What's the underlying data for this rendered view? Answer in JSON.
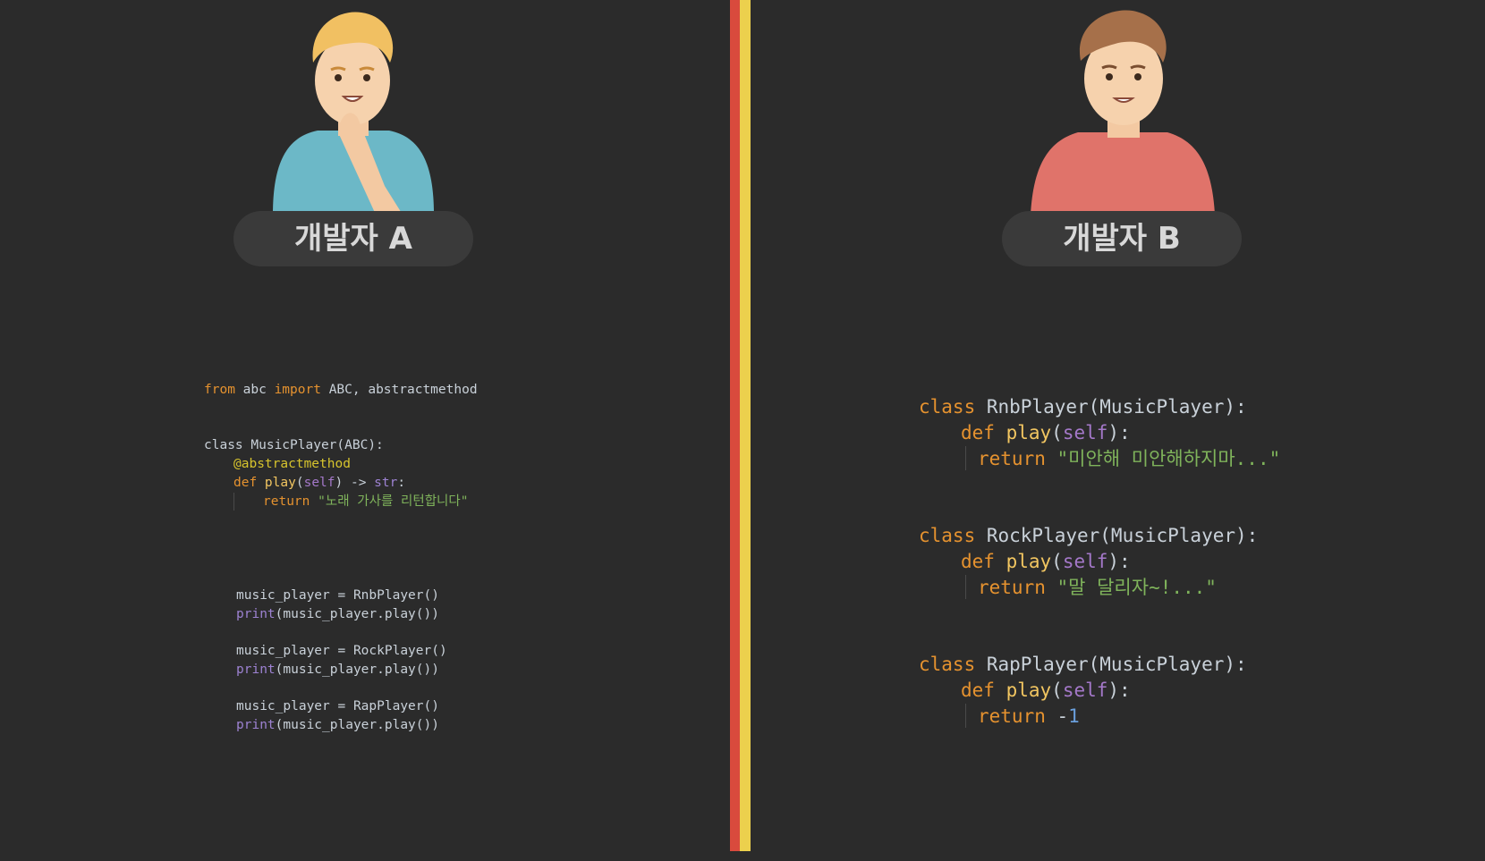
{
  "developer_a": {
    "label": "개발자 A"
  },
  "developer_b": {
    "label": "개발자 B"
  },
  "code_a": {
    "import_from": "from",
    "import_module": " abc ",
    "import_kw": "import",
    "import_names": " ABC, abstractmethod",
    "class_kw": "class",
    "class_decl": " MusicPlayer(ABC):",
    "decorator": "@abstractmethod",
    "def_kw": "def",
    "method_name": " play",
    "method_open": "(",
    "method_self": "self",
    "method_rest": ") -> ",
    "return_type": "str",
    "return_colon": ":",
    "return_kw": "return",
    "return_str": " \"노래 가사를 리턴합니다\"",
    "usage": [
      {
        "assign": "music_player = RnbPlayer()",
        "print_kw": "print",
        "print_args": "(music_player.play())"
      },
      {
        "assign": "music_player = RockPlayer()",
        "print_kw": "print",
        "print_args": "(music_player.play())"
      },
      {
        "assign": "music_player = RapPlayer()",
        "print_kw": "print",
        "print_args": "(music_player.play())"
      }
    ]
  },
  "code_b": {
    "classes": [
      {
        "class_kw": "class",
        "decl": " RnbPlayer(MusicPlayer):",
        "def_kw": "def",
        "method": " play",
        "open": "(",
        "self": "self",
        "close": "):",
        "return_kw": "return",
        "value": " \"미안해 미안해하지마...\"",
        "value_type": "str"
      },
      {
        "class_kw": "class",
        "decl": " RockPlayer(MusicPlayer):",
        "def_kw": "def",
        "method": " play",
        "open": "(",
        "self": "self",
        "close": "):",
        "return_kw": "return",
        "value": " \"말 달리자~!...\"",
        "value_type": "str"
      },
      {
        "class_kw": "class",
        "decl": " RapPlayer(MusicPlayer):",
        "def_kw": "def",
        "method": " play",
        "open": "(",
        "self": "self",
        "close": "):",
        "return_kw": "return",
        "value_prefix": " -",
        "value": "1",
        "value_type": "num"
      }
    ]
  },
  "colors": {
    "background": "#2b2b2b",
    "divider_red": "#d94a3d",
    "divider_yellow": "#ecd04d",
    "shirt_a": "#6cb8c7",
    "shirt_b": "#e0736a"
  }
}
